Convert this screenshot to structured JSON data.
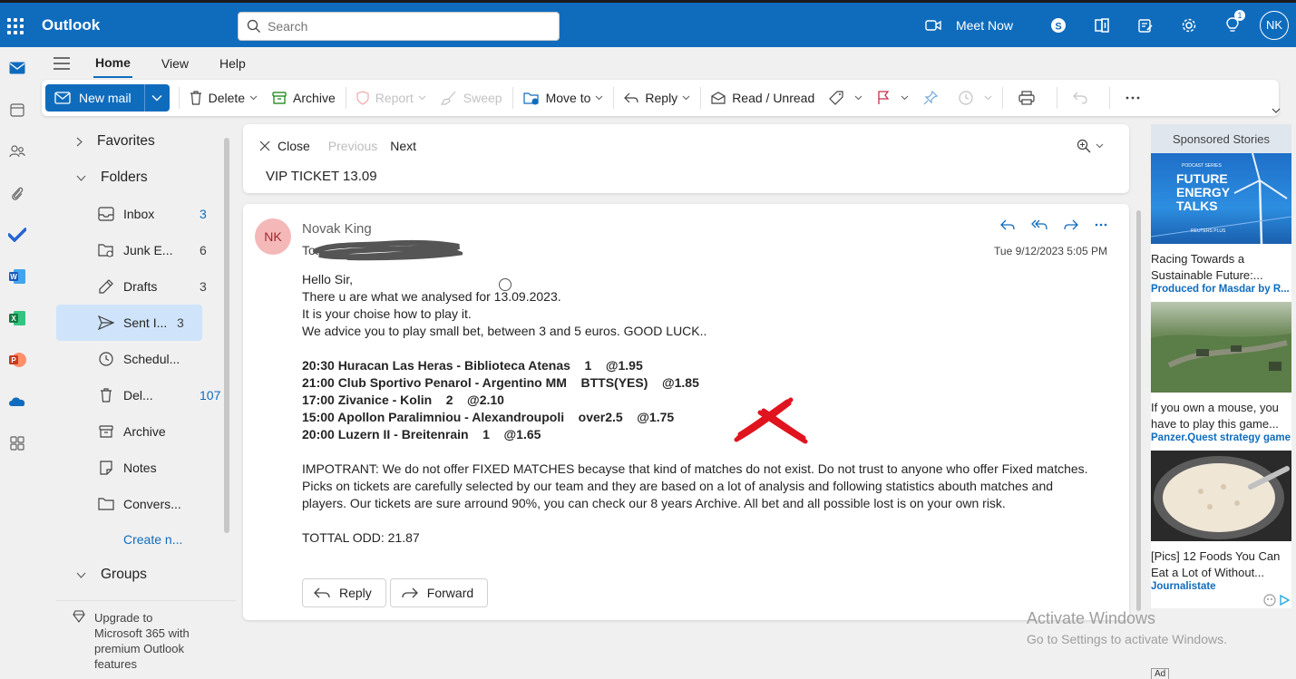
{
  "app": {
    "name": "Outlook"
  },
  "search": {
    "placeholder": "Search"
  },
  "topbar": {
    "meet_now": "Meet Now",
    "user_initials": "NK",
    "notifications": "1"
  },
  "tabs": [
    "Home",
    "View",
    "Help"
  ],
  "toolbar": {
    "new_mail": "New mail",
    "delete": "Delete",
    "archive": "Archive",
    "report": "Report",
    "sweep": "Sweep",
    "move_to": "Move to",
    "reply": "Reply",
    "read_unread": "Read / Unread"
  },
  "folders": {
    "favorites": "Favorites",
    "folders": "Folders",
    "items": [
      {
        "label": "Inbox",
        "count": "3"
      },
      {
        "label": "Junk E...",
        "count": "6"
      },
      {
        "label": "Drafts",
        "count": "3"
      },
      {
        "label": "Sent I...",
        "count": "3"
      },
      {
        "label": "Schedul...",
        "count": ""
      },
      {
        "label": "Del...",
        "count": "107"
      },
      {
        "label": "Archive",
        "count": ""
      },
      {
        "label": "Notes",
        "count": ""
      },
      {
        "label": "Convers...",
        "count": ""
      }
    ],
    "create": "Create n...",
    "groups": "Groups",
    "upgrade": "Upgrade to Microsoft 365 with premium Outlook features"
  },
  "reading": {
    "close": "Close",
    "previous": "Previous",
    "next": "Next",
    "subject": "VIP TICKET 13.09"
  },
  "message": {
    "initials": "NK",
    "sender": "Novak King",
    "to_label": "To:",
    "date": "Tue 9/12/2023 5:05 PM",
    "intro": [
      "Hello Sir,",
      "There u are what we analysed for 13.09.2023.",
      "It is your choise how to play it.",
      "We advice you to play small bet, between 3 and 5 euros. GOOD LUCK.."
    ],
    "tips": [
      "20:30 Huracan Las Heras - Biblioteca Atenas    1    @1.95",
      "21:00 Club Sportivo Penarol - Argentino MM    BTTS(YES)    @1.85",
      "17:00 Zivanice - Kolin    2    @2.10",
      "15:00 Apollon Paralimniou - Alexandroupoli    over2.5    @1.75",
      "20:00 Luzern II - Breitenrain    1    @1.65"
    ],
    "important": "IMPOTRANT: We do not offer FIXED MATCHES becayse that kind of matches do not exist. Do not trust to anyone who offer Fixed matches. Picks on tickets are carefully selected by our team and they are based on a lot of analysis and following statistics abouth matches and players. Our tickets are sure arround 90%, you can check our 8 years Archive. All bet and all possible lost is on your own risk.",
    "total": "TOTTAL ODD: 21.87",
    "reply": "Reply",
    "forward": "Forward"
  },
  "ads": {
    "header": "Sponsored Stories",
    "items": [
      {
        "title": "Racing Towards a Sustainable Future:...",
        "source": "Produced for Masdar by R...",
        "img_text": "FUTURE ENERGY TALKS",
        "img_small": "PODCAST SERIES",
        "img_brand": "REUTERS PLUS"
      },
      {
        "title": "If you own a mouse, you have to play this game...",
        "source": "Panzer.Quest strategy game"
      },
      {
        "title": "[Pics] 12 Foods You Can Eat a Lot of Without...",
        "source": "Journalistate"
      }
    ],
    "ad_label": "Ad"
  },
  "watermark": {
    "title": "Activate Windows",
    "subtitle": "Go to Settings to activate Windows."
  },
  "colors": {
    "brand": "#0f6cbd",
    "selected": "#cfe4fa",
    "avatar": "#f4b8b8"
  }
}
